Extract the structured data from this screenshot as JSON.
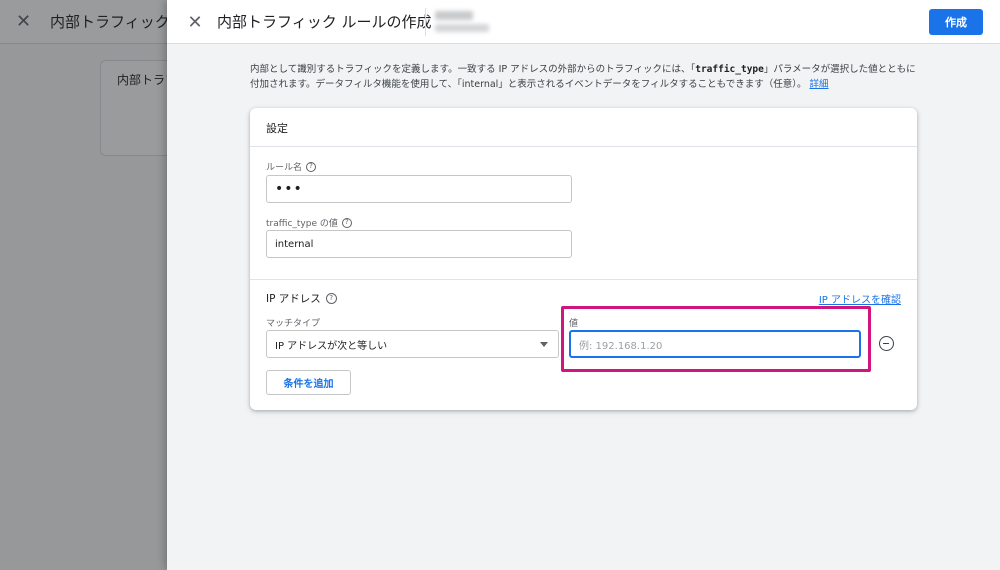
{
  "background": {
    "title": "内部トラフィックの",
    "card_text": "内部トラフ"
  },
  "header": {
    "title": "内部トラフィック ルールの作成",
    "create_label": "作成"
  },
  "description": {
    "part1": "内部として識別するトラフィックを定義します。一致する IP アドレスの外部からのトラフィックには、「",
    "code": "traffic_type",
    "part2": "」パラメータが選択した値とともに付加されます。データフィルタ機能を使用して、「internal」と表示されるイベントデータをフィルタすることもできます（任意）。",
    "link": "詳細"
  },
  "settings": {
    "title": "設定",
    "rule_name_label": "ルール名",
    "rule_name_value": "•••",
    "traffic_type_label": "traffic_type の値",
    "traffic_type_value": "internal"
  },
  "ip_section": {
    "title": "IP アドレス",
    "check_link": "IP アドレスを確認",
    "match_type_label": "マッチタイプ",
    "match_type_value": "IP アドレスが次と等しい",
    "value_label": "値",
    "value_placeholder": "例: 192.168.1.20",
    "add_condition": "条件を追加"
  },
  "colors": {
    "accent": "#1a73e8",
    "highlight": "#d0157f"
  }
}
